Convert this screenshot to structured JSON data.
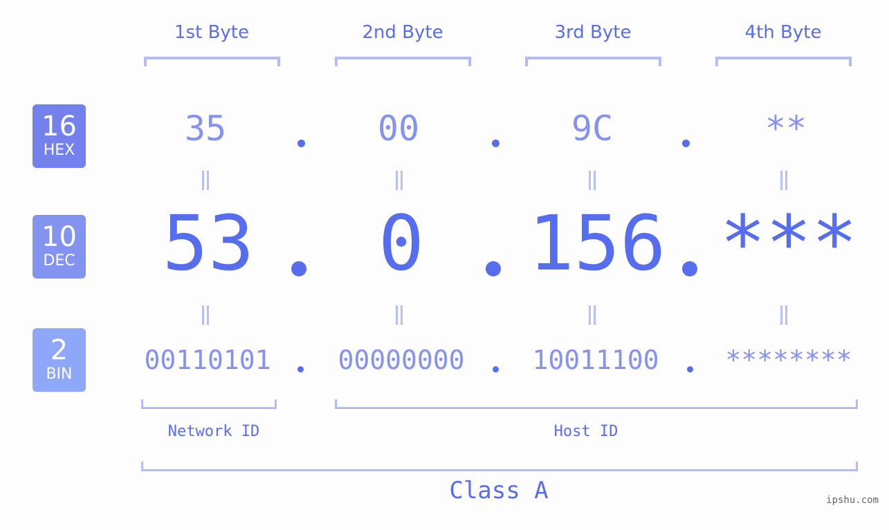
{
  "headers": [
    "1st Byte",
    "2nd Byte",
    "3rd Byte",
    "4th Byte"
  ],
  "badges": {
    "hex": {
      "num": "16",
      "label": "HEX",
      "color": "#7481ec"
    },
    "dec": {
      "num": "10",
      "label": "DEC",
      "color": "#8492f0"
    },
    "bin": {
      "num": "2",
      "label": "BIN",
      "color": "#8fa7f8"
    }
  },
  "hex_values": [
    "35",
    "00",
    "9C",
    "**"
  ],
  "dec_values": [
    "53",
    "0",
    "156",
    "***"
  ],
  "bin_values": [
    "00110101",
    "00000000",
    "10011100",
    "********"
  ],
  "labels": {
    "network_id": "Network ID",
    "host_id": "Host ID",
    "class": "Class A"
  },
  "watermark": "ipshu.com",
  "colors": {
    "accent": "#566ded",
    "light": "#8592ee",
    "bracket": "#b3bcf7"
  }
}
